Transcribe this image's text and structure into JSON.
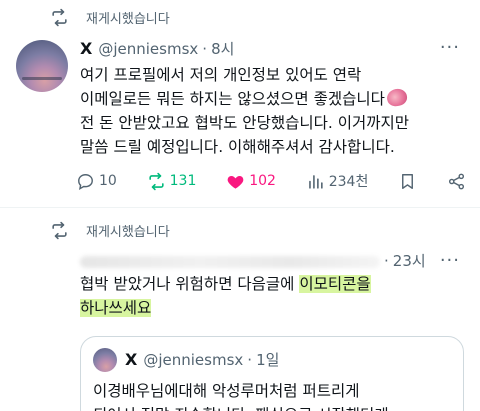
{
  "post1": {
    "repost_label": "재게시했습니다",
    "name": "X",
    "handle": "@jenniesmsx",
    "time": "8시",
    "body": [
      "여기 프로필에서 저의 개인정보 있어도 연락",
      "이메일로든 뭐든 하지는 않으셨으면 좋겠습니다",
      "전 돈 안받았고요 협박도 안당했습니다. 이거까지만",
      "말씀 드릴 예정입니다. 이해해주셔서 감사합니다."
    ],
    "replies": "10",
    "reposts": "131",
    "likes": "102",
    "views": "234천"
  },
  "post2": {
    "repost_label": "재게시했습니다",
    "time": "23시",
    "body_plain": "협박 받았거나 위험하면 다음글에 ",
    "body_highlight1": "이모티콘을",
    "body_highlight2": "하나쓰세요",
    "quote": {
      "name": "X",
      "handle": "@jenniesmsx",
      "time": "1일",
      "lines": [
        "이경배우님에대해 악성루머처럼 퍼트리게",
        "되어서 정말 죄송합니다. 팬심으로 시작했던게"
      ]
    }
  },
  "colors": {
    "repost": "#00ba7c",
    "like": "#f91880",
    "secondary": "#536471",
    "highlight": "#d8f5a0"
  }
}
